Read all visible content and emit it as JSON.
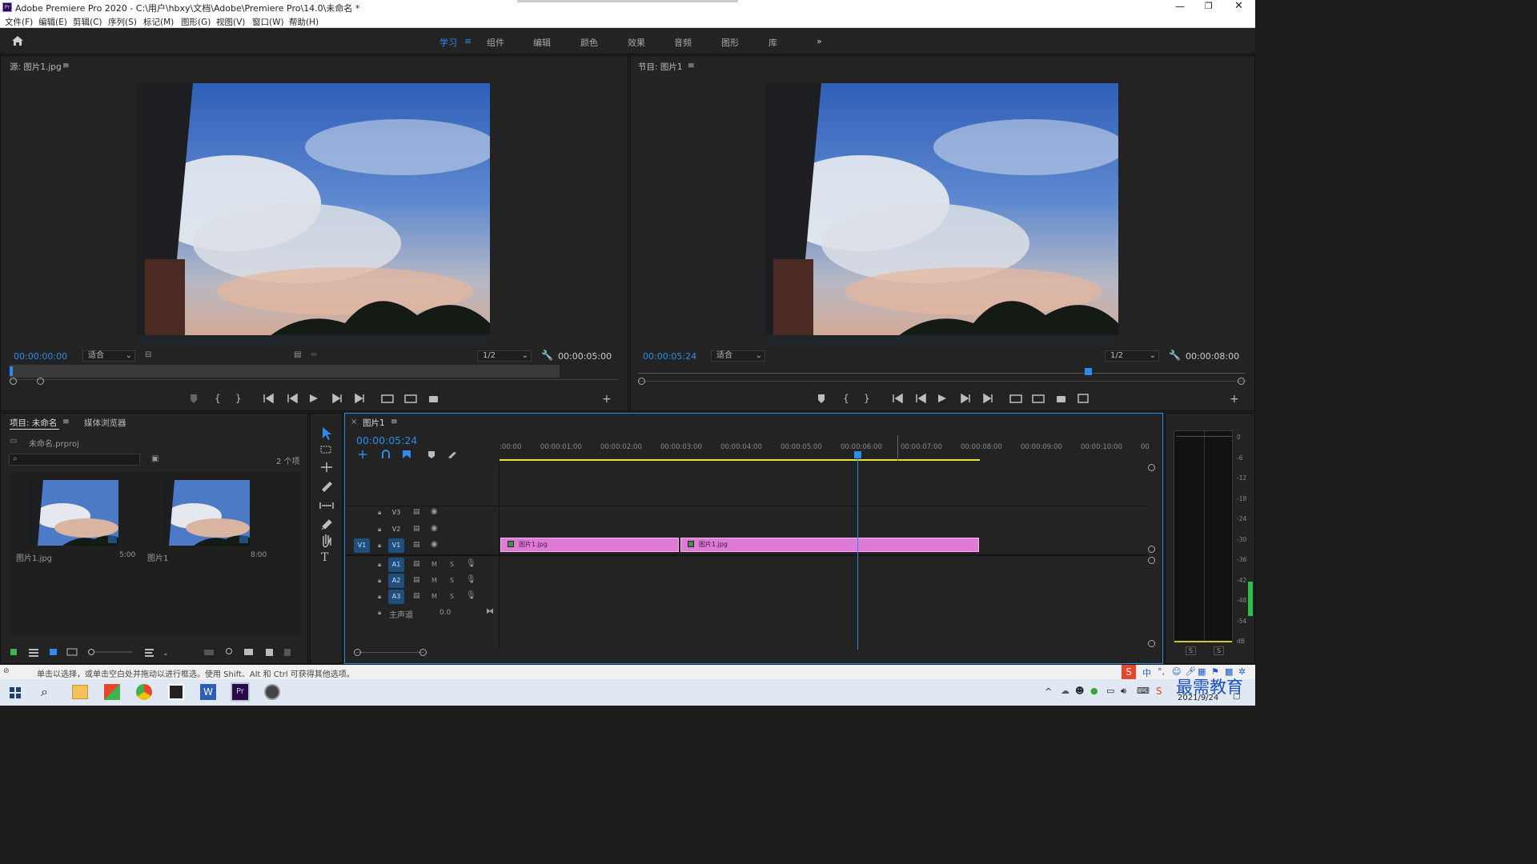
{
  "window": {
    "title": "Adobe Premiere Pro 2020 - C:\\用户\\hbxy\\文档\\Adobe\\Premiere Pro\\14.0\\未命名 *",
    "controls": [
      "minimize-icon",
      "restore-icon",
      "close-icon"
    ]
  },
  "menu": [
    "文件(F)",
    "编辑(E)",
    "剪辑(C)",
    "序列(S)",
    "标记(M)",
    "图形(G)",
    "视图(V)",
    "窗口(W)",
    "帮助(H)"
  ],
  "workspaces": {
    "items": [
      "学习",
      "组件",
      "编辑",
      "颜色",
      "效果",
      "音频",
      "图形",
      "库"
    ],
    "active": "学习",
    "more": "»"
  },
  "source_monitor": {
    "title": "源: 图片1.jpg",
    "timecode": "00:00:00:00",
    "zoom": "适合",
    "resolution": "1/2",
    "duration": "00:00:05:00"
  },
  "program_monitor": {
    "title": "节目: 图片1",
    "timecode": "00:00:05:24",
    "zoom": "适合",
    "resolution": "1/2",
    "duration": "00:00:08:00"
  },
  "project": {
    "tab_active": "项目: 未命名",
    "tab_other": "媒体浏览器",
    "file": "未命名.prproj",
    "count": "2 个项",
    "items": [
      {
        "name": "图片1.jpg",
        "duration": "5:00"
      },
      {
        "name": "图片1",
        "duration": "8:00"
      }
    ]
  },
  "timeline": {
    "tab": "图片1",
    "timecode": "00:00:05:24",
    "ruler": [
      ":00:00",
      "00:00:01:00",
      "00:00:02:00",
      "00:00:03:00",
      "00:00:04:00",
      "00:00:05:00",
      "00:00:06:00",
      "00:00:07:00",
      "00:00:08:00",
      "00:00:09:00",
      "00:00:10:00",
      "00"
    ],
    "video_tracks": [
      "V3",
      "V2",
      "V1"
    ],
    "audio_tracks": [
      "A1",
      "A2",
      "A3"
    ],
    "source_patch": "V1",
    "master_label": "主声道",
    "master_value": "0.0",
    "m_label": "M",
    "s_label": "S",
    "clips": [
      {
        "name": "图片1.jpg",
        "start": 0,
        "end": 3
      },
      {
        "name": "图片1.jpg",
        "start": 3,
        "end": 8
      }
    ],
    "playhead": 5.96
  },
  "meter": {
    "labels": [
      "0",
      "-6",
      "-12",
      "-18",
      "-24",
      "-30",
      "-36",
      "-42",
      "-48",
      "-54",
      "dB"
    ],
    "solo": [
      "S",
      "S"
    ]
  },
  "status_bar": {
    "text": "单击以选择，或单击空白处并拖动以进行框选。使用 Shift、Alt 和 Ctrl 可获得其他选项。"
  },
  "taskbar": {
    "date": "2021/9/24",
    "ime": "中",
    "watermark": "最需教育"
  },
  "colors": {
    "accent": "#2d8ceb",
    "clip": "#e07ad7",
    "panel": "#232323"
  }
}
